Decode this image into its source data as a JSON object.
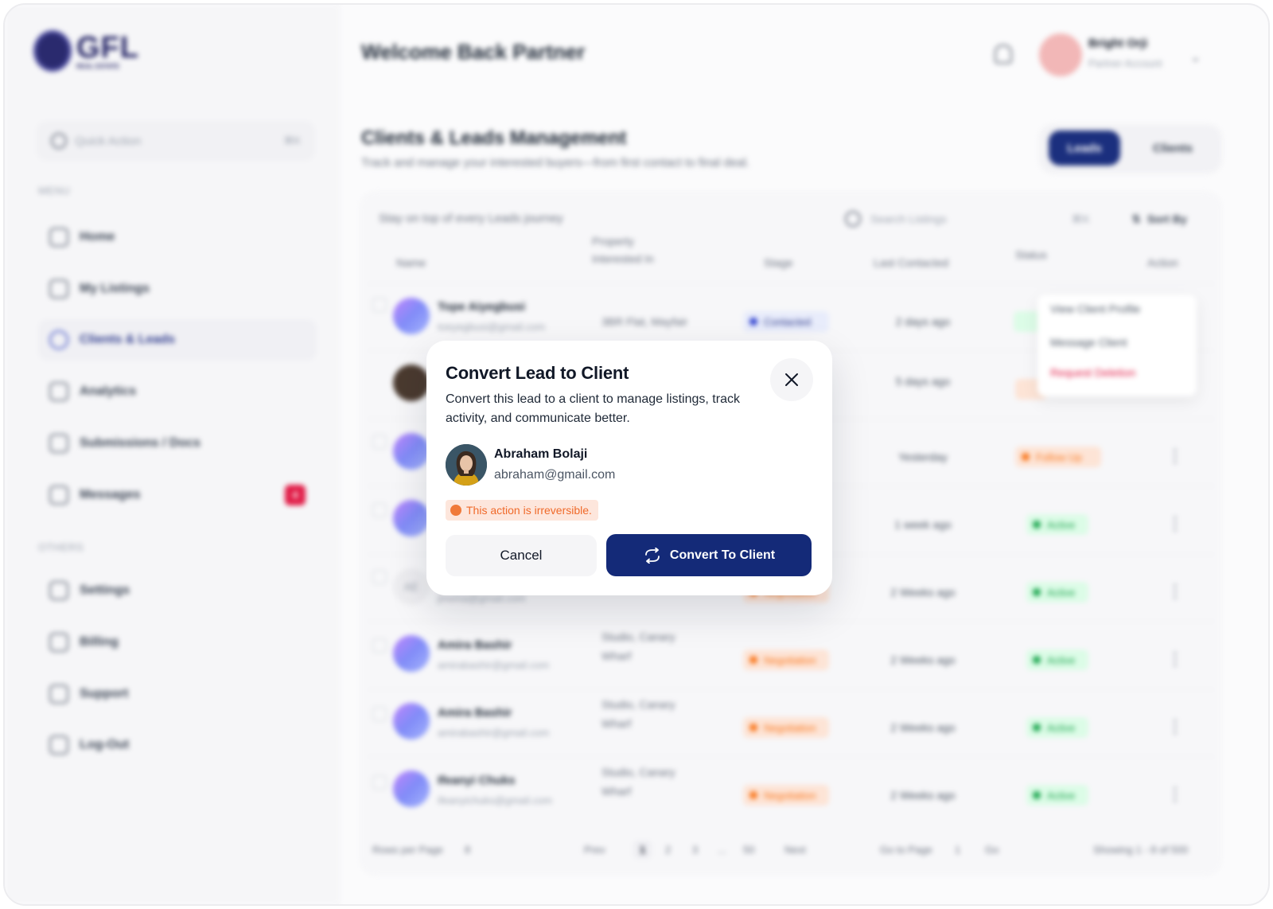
{
  "brand": {
    "logo_text": "GFL",
    "logo_sub": "REAL ESTATE"
  },
  "header": {
    "welcome": "Welcome Back Partner",
    "user_name": "Bright Orji",
    "user_role": "Partner Account"
  },
  "sidebar": {
    "quick_action": {
      "placeholder": "Quick Action",
      "shortcut": "⌘K"
    },
    "menu_label": "MENU",
    "menu_items": [
      {
        "label": "Home"
      },
      {
        "label": "My Listings"
      },
      {
        "label": "Clients & Leads"
      },
      {
        "label": "Analytics"
      },
      {
        "label": "Submissions / Docs"
      },
      {
        "label": "Messages",
        "badge": "4"
      }
    ],
    "others_label": "OTHERS",
    "other_items": [
      {
        "label": "Settings"
      },
      {
        "label": "Billing"
      },
      {
        "label": "Support"
      },
      {
        "label": "Log-Out"
      }
    ]
  },
  "page": {
    "title": "Clients & Leads Management",
    "subtitle": "Track and manage your interested buyers—from first contact to final deal.",
    "tabs": {
      "leads": "Leads",
      "clients": "Clients"
    }
  },
  "table": {
    "intro": "Stay on top of every Leads journey",
    "search_placeholder": "Search Listings",
    "search_shortcut": "⌘K",
    "sort_label": "Sort By",
    "headers": {
      "name": "Name",
      "property": "Property Interested In",
      "stage": "Stage",
      "last": "Last Contacted",
      "status": "Status",
      "action": "Action"
    },
    "rows": [
      {
        "name": "Tope Aiyegbusi",
        "email": "toeyegbusi@gmail.com",
        "property": "3BR Flat, Mayfair",
        "stage": "Contacted",
        "last": "2 days ago"
      },
      {
        "name": "",
        "email": "",
        "property": "",
        "stage": "",
        "last": "5 days ago",
        "status": "Follow Up"
      },
      {
        "name": "",
        "email": "",
        "property": "",
        "stage": "",
        "last": "Yesterday",
        "status": "Follow Up"
      },
      {
        "name": "",
        "email": "",
        "property": "",
        "stage": "",
        "last": "1 week ago",
        "status": "Active"
      },
      {
        "name": "",
        "email": "jinoma@gmail.com",
        "initials": "AE",
        "property": "",
        "stage": "Negotiation",
        "last": "2 Weeks ago",
        "status": "Active"
      },
      {
        "name": "Amira Bashir",
        "email": "amirabashir@gmail.com",
        "property": "Studio, Canary Wharf",
        "stage": "Negotiation",
        "last": "2 Weeks ago",
        "status": "Active"
      },
      {
        "name": "Amira Bashir",
        "email": "amirabashir@gmail.com",
        "property": "Studio, Canary Wharf",
        "stage": "Negotiation",
        "last": "2 Weeks ago",
        "status": "Active"
      },
      {
        "name": "Ifeanyi Chuks",
        "email": "ifeanyichuks@gmail.com",
        "property": "Studio, Canary Wharf",
        "stage": "Negotiation",
        "last": "2 Weeks ago",
        "status": "Active"
      }
    ],
    "context_menu": {
      "view": "View Client Profile",
      "message": "Message Client",
      "delete": "Request Deletion"
    },
    "pagination": {
      "rows_label": "Rows per Page",
      "rows_value": "8",
      "prev": "Prev",
      "p1": "1",
      "p2": "2",
      "p3": "3",
      "ellipsis": "...",
      "p_last": "50",
      "next": "Next",
      "goto": "Go to Page",
      "goto_value": "1",
      "go": "Go",
      "showing": "Showing 1 - 8 of 500"
    }
  },
  "modal": {
    "title": "Convert Lead to Client",
    "description": "Convert this lead to a client to manage listings, track activity, and communicate better.",
    "lead_name": "Abraham Bolaji",
    "lead_email": "abraham@gmail.com",
    "warning": "This action is irreversible.",
    "cancel_label": "Cancel",
    "convert_label": "Convert To Client"
  },
  "colors": {
    "primary": "#142a78",
    "warning_bg": "#fde6dc",
    "warning_text": "#f06a2a",
    "danger": "#e11d48"
  },
  "icons": {
    "close": "close-icon",
    "convert": "refresh-icon",
    "bell": "bell-icon",
    "search": "search-icon"
  }
}
